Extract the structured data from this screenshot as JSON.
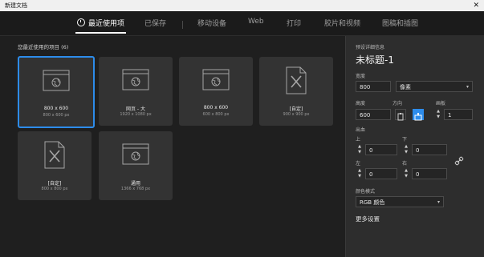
{
  "window": {
    "title": "新建文档",
    "close_glyph": "✕"
  },
  "tabs": [
    {
      "label": "最近使用项",
      "active": true
    },
    {
      "label": "已保存",
      "active": false
    },
    {
      "label": "移动设备",
      "active": false
    },
    {
      "label": "Web",
      "active": false
    },
    {
      "label": "打印",
      "active": false
    },
    {
      "label": "胶片和视频",
      "active": false
    },
    {
      "label": "图稿和插图",
      "active": false
    }
  ],
  "recent": {
    "label": "您最近使用的项目 (6)",
    "items": [
      {
        "name": "800 x 600",
        "dims": "800 x 600 px",
        "icon": "browser-icon",
        "selected": true
      },
      {
        "name": "网页 - 大",
        "dims": "1920 x 1080 px",
        "icon": "browser-icon",
        "selected": false
      },
      {
        "name": "800 x 600",
        "dims": "600 x 800 px",
        "icon": "browser-icon",
        "selected": false
      },
      {
        "name": "[自定]",
        "dims": "900 x 900 px",
        "icon": "custom-doc-icon",
        "selected": false
      },
      {
        "name": "[自定]",
        "dims": "800 x 800 px",
        "icon": "custom-doc-icon",
        "selected": false
      },
      {
        "name": "通用",
        "dims": "1366 x 768 px",
        "icon": "browser-icon",
        "selected": false
      }
    ]
  },
  "details": {
    "section_label": "预设详细信息",
    "doc_name": "未标题-1",
    "width_label": "宽度",
    "width_value": "800",
    "unit": "像素",
    "height_label": "高度",
    "height_value": "600",
    "orientation_label": "方向",
    "artboard_label": "画板",
    "artboard_value": "1",
    "bleed_label": "出血",
    "top_label": "上",
    "top_value": "0",
    "bottom_label": "下",
    "bottom_value": "0",
    "left_label": "左",
    "left_value": "0",
    "right_label": "右",
    "right_value": "0",
    "color_mode_label": "颜色模式",
    "color_mode": "RGB 颜色",
    "more_settings": "更多设置"
  },
  "colors": {
    "accent": "#2d8ceb",
    "panel": "#2d2d2d",
    "card": "#333333"
  }
}
